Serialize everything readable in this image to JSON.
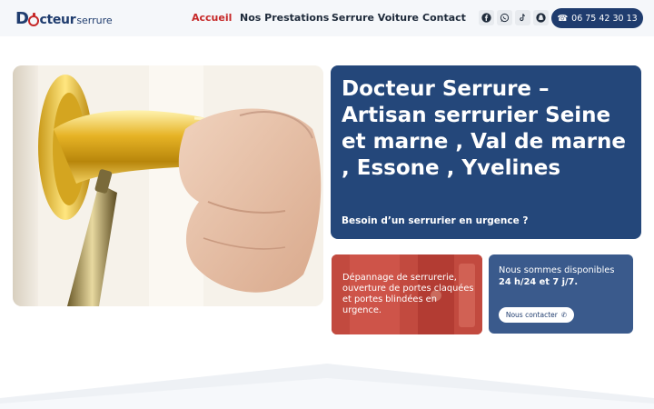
{
  "header": {
    "logo": {
      "prefix": "D",
      "middle": "cteur",
      "suffix": "serrure"
    },
    "nav": [
      {
        "label": "Accueil",
        "active": true
      },
      {
        "label": "Nos Prestations",
        "active": false
      },
      {
        "label": "Serrure Voiture",
        "active": false
      },
      {
        "label": "Contact",
        "active": false
      }
    ],
    "social_icons": [
      "facebook-icon",
      "whatsapp-icon",
      "tiktok-icon",
      "snapchat-icon"
    ],
    "phone": {
      "icon": "phone-icon",
      "number": "06 75 42 30 13"
    }
  },
  "hero": {
    "title": "Docteur Serrure – Artisan serrurier Seine et marne , Val de marne , Essone , Yvelines",
    "subtitle": "Besoin d’un serrurier en urgence ?"
  },
  "cards": {
    "depannage": "Dépannage de serrurerie, ouverture de portes claquées et portes blindées en urgence.",
    "availability_line1": "Nous sommes disponibles",
    "availability_line2": "24 h/24 et 7 j/7.",
    "contact_button": "Nous contacter"
  },
  "colors": {
    "brand_blue": "#24477a",
    "accent_red": "#c62828",
    "card_blue": "#3a5a8c"
  }
}
